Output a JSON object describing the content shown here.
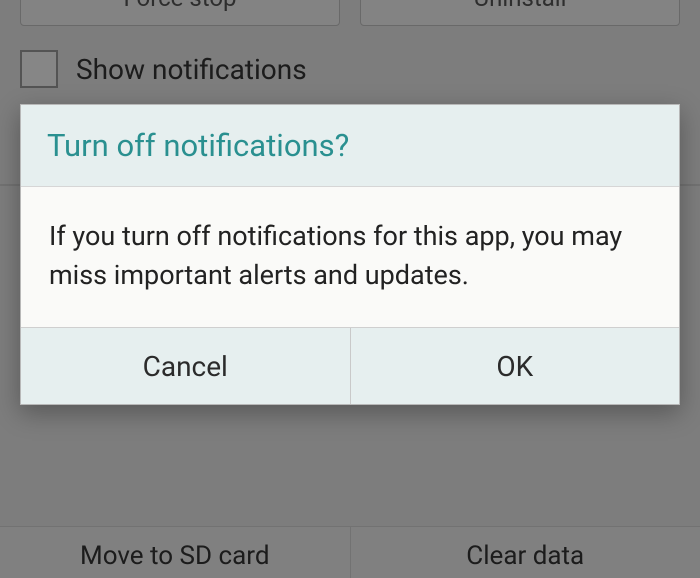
{
  "background": {
    "buttons": {
      "force_stop": "Force stop",
      "uninstall": "Uninstall"
    },
    "checkbox_label": "Show notifications",
    "bottom_buttons": {
      "move_sd": "Move to SD card",
      "clear_data": "Clear data"
    }
  },
  "dialog": {
    "title": "Turn off notifications?",
    "message": "If you turn off notifications for this app, you may miss important alerts and updates.",
    "cancel": "Cancel",
    "ok": "OK"
  }
}
